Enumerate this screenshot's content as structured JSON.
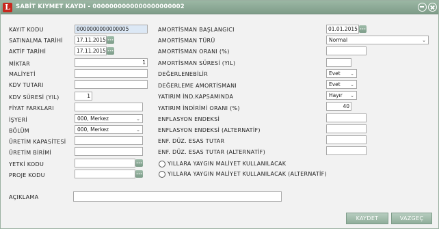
{
  "window": {
    "title": "SABİT KIYMET KAYDI - 0000000000000000000002",
    "app_icon_letter": "L"
  },
  "left": {
    "kayit_kodu": {
      "label": "KAYIT KODU",
      "value": "0000000000000005"
    },
    "satinalma_tarihi": {
      "label": "SATINALMA TARİHİ",
      "value": "17.11.2015"
    },
    "aktif_tarihi": {
      "label": "AKTİF TARİHİ",
      "value": "17.11.2015"
    },
    "miktar": {
      "label": "MİKTAR",
      "value": "1"
    },
    "maliyeti": {
      "label": "MALİYETİ",
      "value": ""
    },
    "kdv_tutari": {
      "label": "KDV TUTARI",
      "value": ""
    },
    "kdv_suresi": {
      "label": "KDV SÜRESİ (YIL)",
      "value": "1"
    },
    "fiyat_farklari": {
      "label": "FİYAT FARKLARI",
      "value": ""
    },
    "isyeri": {
      "label": "İŞYERİ",
      "value": "000, Merkez"
    },
    "bolum": {
      "label": "BÖLÜM",
      "value": "000, Merkez"
    },
    "uretim_kapasitesi": {
      "label": "ÜRETİM KAPASİTESİ",
      "value": ""
    },
    "uretim_birimi": {
      "label": "ÜRETİM BİRİMİ",
      "value": ""
    },
    "yetki_kodu": {
      "label": "YETKİ KODU",
      "value": ""
    },
    "proje_kodu": {
      "label": "PROJE KODU",
      "value": ""
    },
    "aciklama": {
      "label": "AÇIKLAMA",
      "value": ""
    }
  },
  "right": {
    "amortisman_baslangici": {
      "label": "AMORTİSMAN BAŞLANGICI",
      "value": "01.01.2015"
    },
    "amortisman_turu": {
      "label": "AMORTİSMAN TÜRÜ",
      "value": "Normal"
    },
    "amortisman_orani": {
      "label": "AMORTİSMAN ORANI (%)",
      "value": ""
    },
    "amortisman_suresi": {
      "label": "AMORTİSMAN SÜRESİ (YIL)",
      "value": ""
    },
    "degerlenebilir": {
      "label": "DEĞERLENEBİLİR",
      "value": "Evet"
    },
    "degerleme_amortismani": {
      "label": "DEĞERLEME AMORTİSMANI",
      "value": "Evet"
    },
    "yatirim_ind_kapsaminda": {
      "label": "YATIRIM İND.KAPSAMINDA",
      "value": "Hayır"
    },
    "yatirim_indirimi_orani": {
      "label": "YATIRIM İNDİRİMİ ORANI (%)",
      "value": "40"
    },
    "enflasyon_endeksi": {
      "label": "ENFLASYON ENDEKSİ",
      "value": ""
    },
    "enflasyon_endeksi_alt": {
      "label": "ENFLASYON ENDEKSİ  (ALTERNATİF)",
      "value": ""
    },
    "enf_duz_esas_tutar": {
      "label": "ENF. DÜZ. ESAS TUTAR",
      "value": ""
    },
    "enf_duz_esas_tutar_alt": {
      "label": "ENF. DÜZ. ESAS TUTAR (ALTERNATİF)",
      "value": ""
    },
    "yillara_yaygin": {
      "label": "YILLARA YAYGIN MALİYET KULLANILACAK"
    },
    "yillara_yaygin_alt": {
      "label": "YILLARA YAYGIN MALİYET KULLANILACAK (ALTERNATİF)"
    }
  },
  "buttons": {
    "kaydet": "KAYDET",
    "vazgec": "VAZGEÇ"
  }
}
